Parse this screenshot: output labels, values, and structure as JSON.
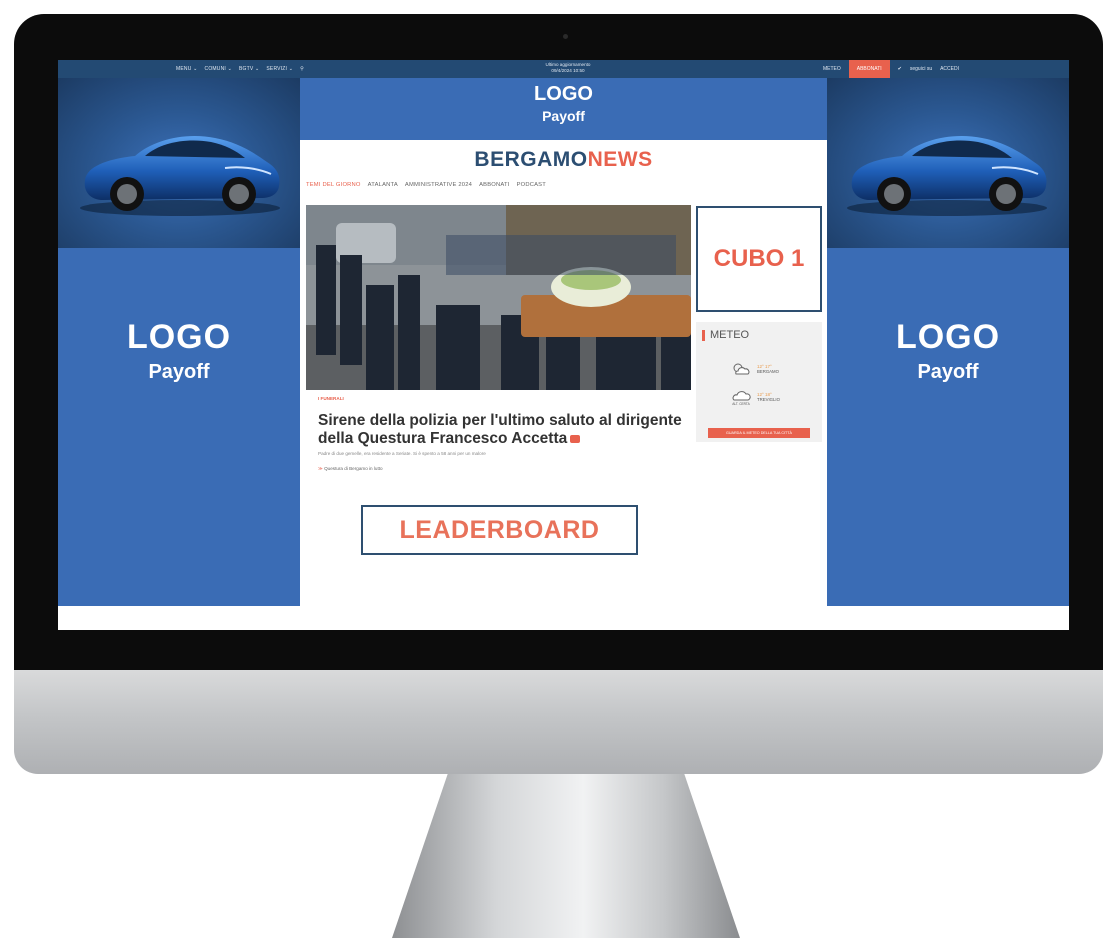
{
  "topbar": {
    "menu_items": [
      "MENU",
      "COMUNI",
      "BGTV",
      "SERVIZI"
    ],
    "update_label": "Ultimo aggiornamento",
    "update_time": "09/4/2024 10:50",
    "meteo": "METEO",
    "abbonati": "ABBONATI",
    "social": "seguici su",
    "accedi": "ACCEDI"
  },
  "skin": {
    "top_logo": "LOGO",
    "top_payoff": "Payoff",
    "left_logo": "LOGO",
    "left_payoff": "Payoff",
    "right_logo": "LOGO",
    "right_payoff": "Payoff"
  },
  "site": {
    "brand_part1": "BERGAMO",
    "brand_part2": "NEWS",
    "menu": [
      "TEMI DEL GIORNO",
      "ATALANTA",
      "AMMINISTRATIVE 2024",
      "ABBONATI",
      "PODCAST"
    ],
    "active_menu": "TEMI DEL GIORNO"
  },
  "article": {
    "kicker": "I FUNERALI",
    "headline": "Sirene della polizia per l'ultimo saluto al dirigente della Questura Francesco Accetta",
    "subtext": "Padre di due gemelle, era residente a Seriate. Si è spento a 58 anni per un malore",
    "related": "Questura di Bergamo in lutto"
  },
  "ads": {
    "leaderboard": "LEADERBOARD",
    "cubo": "CUBO 1"
  },
  "meteo": {
    "title": "METEO",
    "row1_city": "BERGAMO",
    "row1_temps": "12° 17°",
    "row2_city": "TREVIGLIO",
    "row2_temps": "12° 18°",
    "row2_note": "ALT. CERTA",
    "button": "GUARDA IL METEO DELLA TUA CITTÀ"
  },
  "colors": {
    "accent": "#e8614d",
    "skin_blue": "#3a6cb5",
    "topbar": "#234a73",
    "brand_navy": "#2c4e72"
  }
}
